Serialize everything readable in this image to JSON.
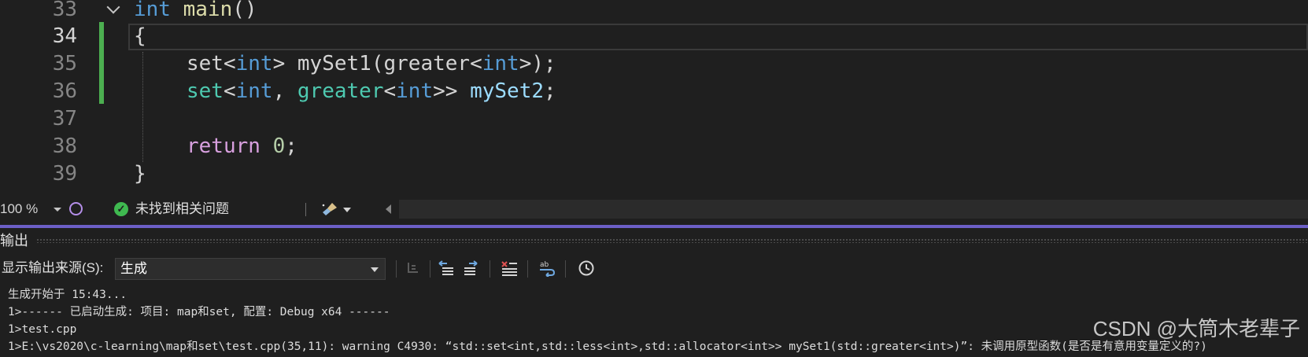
{
  "editor": {
    "lines": [
      {
        "num": "33"
      },
      {
        "num": "34"
      },
      {
        "num": "35"
      },
      {
        "num": "36"
      },
      {
        "num": "37"
      },
      {
        "num": "38"
      },
      {
        "num": "39"
      }
    ],
    "line33": {
      "kw": "int",
      "name": " main",
      "paren": "()"
    },
    "line34": {
      "brace": "{"
    },
    "line35": {
      "p1": "set",
      "p2": "<",
      "p3": "int",
      "p4": "> ",
      "p5": "mySet1",
      "p6": "(",
      "p7": "greater",
      "p8": "<",
      "p9": "int",
      "p10": ">);"
    },
    "line36": {
      "p1": "set",
      "p2": "<",
      "p3": "int",
      "p4": ", ",
      "p5": "greater",
      "p6": "<",
      "p7": "int",
      "p8": ">> ",
      "p9": "mySet2",
      "p10": ";"
    },
    "line38": {
      "kw": "return",
      "sp": " ",
      "num": "0",
      "semi": ";"
    },
    "line39": {
      "brace": "}"
    }
  },
  "editor_status": {
    "zoom": "100 %",
    "issues": "未找到相关问题"
  },
  "output": {
    "title": "输出",
    "source_label": "显示输出来源(S):",
    "source_value": "生成",
    "lines": [
      "生成开始于 15:43...",
      "1>------ 已启动生成: 项目: map和set, 配置: Debug x64 ------",
      "1>test.cpp",
      "1>E:\\vs2020\\c-learning\\map和set\\test.cpp(35,11): warning C4930: “std::set<int,std::less<int>,std::allocator<int>> mySet1(std::greater<int>)”: 未调用原型函数(是否是有意用变量定义的?)"
    ]
  },
  "watermark": "CSDN @大筒木老辈子",
  "colors": {
    "accent_purple": "#6c5fc7",
    "change_bar_green": "#4caf50",
    "keyword_blue": "#569cd6",
    "type_teal": "#4ec9b0"
  }
}
